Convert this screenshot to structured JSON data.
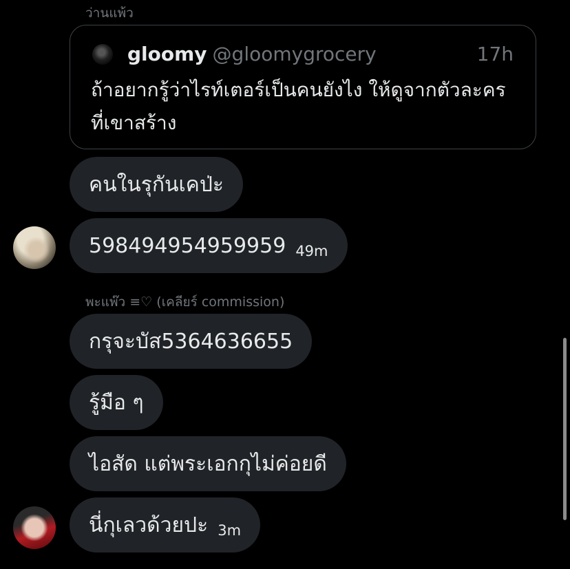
{
  "quoted_sender": "ว่านแพ้ว",
  "quote": {
    "name": "gloomy",
    "handle": "@gloomygrocery",
    "time": "17h",
    "text": "ถ้าอยากรู้ว่าไรท์เตอร์เป็นคนยังไง ให้ดูจากตัวละครที่เขาสร้าง"
  },
  "messages_group1": [
    {
      "text": "คนในรุกันเคป่ะ"
    },
    {
      "text": "598494954959959",
      "time": "49m"
    }
  ],
  "sender2_name": "พะแพ๊ว ≡♡ (เคลียร์ commission)",
  "messages_group2": [
    {
      "text": "กรุจะบัส5364636655"
    },
    {
      "text": "รู้มือ ๆ"
    },
    {
      "text": "ไอสัด แต่พระเอกกุไม่ค่อยดี"
    },
    {
      "text": "นี่กุเลวด้วยปะ",
      "time": "3m"
    }
  ],
  "colors": {
    "background": "#000000",
    "bubble": "#202327",
    "text": "#e7e9ea",
    "muted": "#71767b",
    "border": "#3e4144"
  }
}
